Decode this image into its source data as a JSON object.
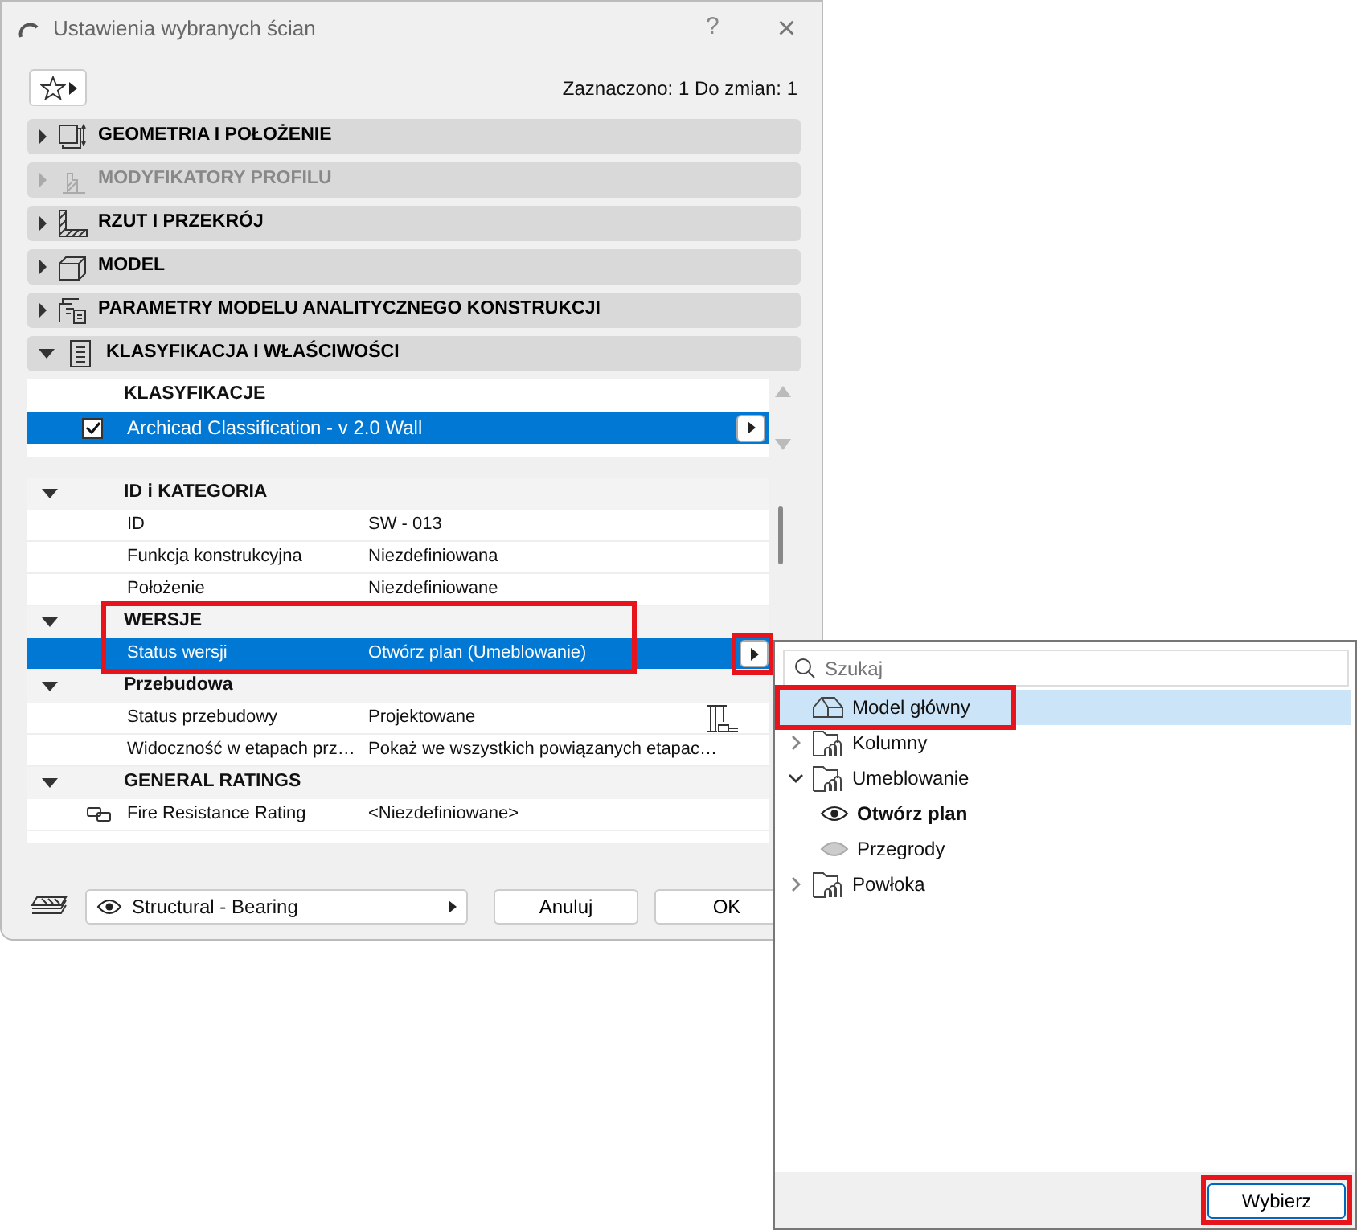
{
  "window": {
    "title": "Ustawienia wybranych ścian",
    "help": "?",
    "close": "×"
  },
  "toolbar": {
    "summary": "Zaznaczono: 1 Do zmian: 1"
  },
  "panels": [
    {
      "title": "GEOMETRIA I POŁOŻENIE",
      "kind": "geometry",
      "expanded": false,
      "disabled": false
    },
    {
      "title": "MODYFIKATORY PROFILU",
      "kind": "profile",
      "expanded": false,
      "disabled": true
    },
    {
      "title": "RZUT I PRZEKRÓJ",
      "kind": "plan",
      "expanded": false,
      "disabled": false
    },
    {
      "title": "MODEL",
      "kind": "model",
      "expanded": false,
      "disabled": false
    },
    {
      "title": "PARAMETRY MODELU ANALITYCZNEGO KONSTRUKCJI",
      "kind": "analytic",
      "expanded": false,
      "disabled": false
    },
    {
      "title": "KLASYFIKACJA I WŁAŚCIWOŚCI",
      "kind": "document",
      "expanded": true,
      "disabled": false
    }
  ],
  "classifications": {
    "title": "KLASYFIKACJE",
    "rows": [
      {
        "label": "Archicad Classification - v 2.0 Wall",
        "checked": true,
        "selected": true
      }
    ]
  },
  "property_groups": [
    {
      "name": "ID i KATEGORIA",
      "expanded": true,
      "highlighted": false,
      "rows": [
        {
          "label": "ID",
          "value": "SW - 013",
          "kind": "plain",
          "selected": false,
          "highlighted": false
        },
        {
          "label": "Funkcja konstrukcyjna",
          "value": "Niezdefiniowana",
          "kind": "plain",
          "selected": false,
          "highlighted": false
        },
        {
          "label": "Położenie",
          "value": "Niezdefiniowane",
          "kind": "plain",
          "selected": false,
          "highlighted": false
        }
      ]
    },
    {
      "name": "WERSJE",
      "expanded": true,
      "highlighted": true,
      "rows": [
        {
          "label": "Status wersji",
          "value": "Otwórz plan (Umeblowanie)",
          "kind": "picker",
          "selected": true,
          "highlighted": true
        }
      ]
    },
    {
      "name": "Przebudowa",
      "expanded": true,
      "highlighted": false,
      "rows": [
        {
          "label": "Status przebudowy",
          "value": "Projektowane",
          "kind": "override",
          "selected": false,
          "highlighted": false
        },
        {
          "label": "Widoczność w etapach prz…",
          "value": "Pokaż we wszystkich powiązanych etapac…",
          "kind": "plain",
          "selected": false,
          "highlighted": false
        }
      ]
    },
    {
      "name": "GENERAL RATINGS",
      "expanded": true,
      "highlighted": false,
      "rows": [
        {
          "label": "Fire Resistance Rating",
          "value": "<Niezdefiniowane>",
          "kind": "linked",
          "selected": false,
          "highlighted": false
        }
      ]
    }
  ],
  "footer": {
    "view": "Structural - Bearing",
    "buttons": [
      "Anuluj",
      "OK"
    ]
  },
  "picker": {
    "placeholder": "Szukaj",
    "items": [
      {
        "label": "Model główny",
        "kind": "model",
        "selected": true,
        "highlighted": true
      },
      {
        "label": "Kolumny",
        "kind": "folder",
        "expanded": false,
        "selected": false,
        "highlighted": false
      },
      {
        "label": "Umeblowanie",
        "kind": "folder",
        "expanded": true,
        "selected": false,
        "highlighted": false,
        "children": [
          {
            "label": "Otwórz plan",
            "kind": "view",
            "current": true,
            "selected": false,
            "highlighted": false
          },
          {
            "label": "Przegrody",
            "kind": "view",
            "current": false,
            "selected": false,
            "highlighted": false
          }
        ]
      },
      {
        "label": "Powłoka",
        "kind": "folder",
        "expanded": false,
        "selected": false,
        "highlighted": false
      }
    ],
    "button": "Wybierz",
    "button_highlighted": true
  }
}
